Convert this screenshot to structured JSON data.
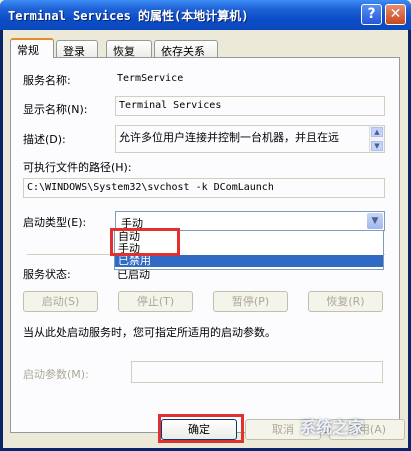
{
  "window": {
    "title": "Terminal Services 的属性(本地计算机)",
    "help_label": "?",
    "close_label": "✕"
  },
  "tabs": [
    {
      "label": "常规"
    },
    {
      "label": "登录"
    },
    {
      "label": "恢复"
    },
    {
      "label": "依存关系"
    }
  ],
  "general": {
    "service_name_label": "服务名称:",
    "service_name_value": "TermService",
    "display_name_label": "显示名称(N):",
    "display_name_value": "Terminal Services",
    "description_label": "描述(D):",
    "description_value": "允许多位用户连接并控制一台机器，并且在远",
    "exe_path_label": "可执行文件的路径(H):",
    "exe_path_value": "C:\\WINDOWS\\System32\\svchost -k DComLaunch",
    "startup_type_label": "启动类型(E):",
    "startup_type_value": "手动",
    "startup_options": [
      "自动",
      "手动",
      "已禁用"
    ],
    "status_label": "服务状态:",
    "status_value": "已启动",
    "buttons": {
      "start": "启动(S)",
      "stop": "停止(T)",
      "pause": "暂停(P)",
      "resume": "恢复(R)"
    },
    "hint": "当从此处启动服务时，您可指定所适用的启动参数。",
    "params_label": "启动参数(M):"
  },
  "footer": {
    "ok": "确定",
    "cancel": "取消",
    "apply": "应用(A)"
  },
  "watermark": "系统之家"
}
